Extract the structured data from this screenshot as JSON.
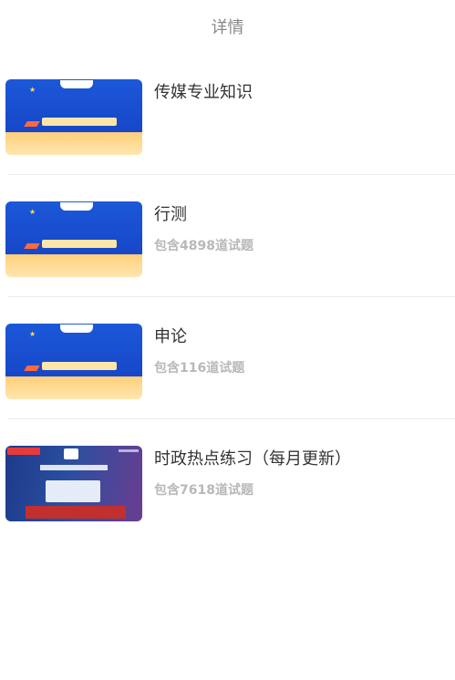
{
  "header": {
    "title": "详情"
  },
  "items": [
    {
      "title": "传媒专业知识",
      "subtitle": "",
      "thumb_icon": "question-bank-banner-icon"
    },
    {
      "title": "行测",
      "subtitle": "包含4898道试题",
      "thumb_icon": "question-bank-banner-icon"
    },
    {
      "title": "申论",
      "subtitle": "包含116道试题",
      "thumb_icon": "question-bank-banner-icon"
    },
    {
      "title": "时政热点练习（每月更新）",
      "subtitle": "包含7618道试题",
      "thumb_icon": "current-affairs-banner-icon"
    }
  ],
  "colors": {
    "title": "#333333",
    "subtitle": "#b8b8b8",
    "header": "#888888",
    "divider": "#ececec"
  }
}
